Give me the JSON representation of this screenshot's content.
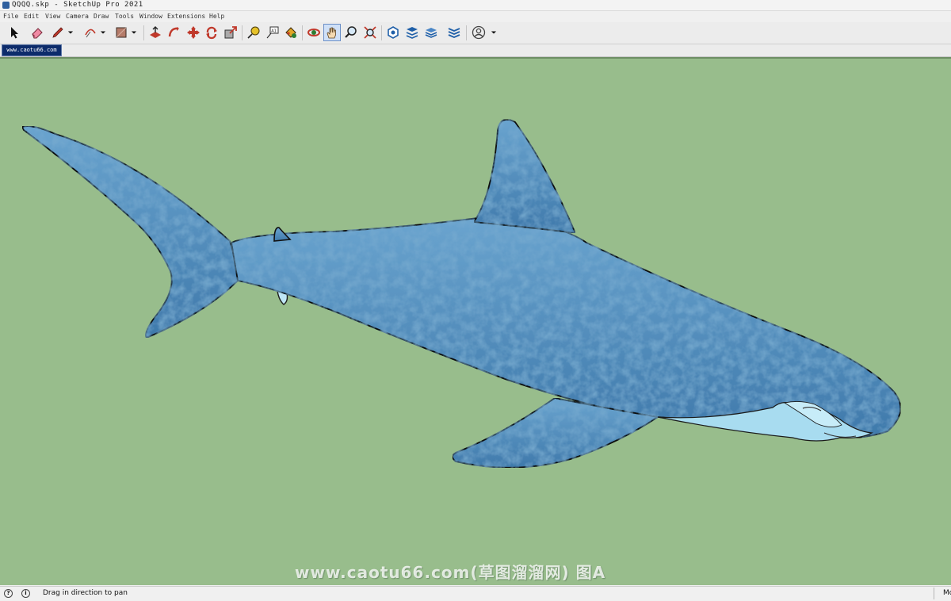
{
  "window": {
    "title": "QQQQ.skp - SketchUp Pro 2021"
  },
  "menu": [
    "File",
    "Edit",
    "View",
    "Camera",
    "Draw",
    "Tools",
    "Window",
    "Extensions",
    "Help"
  ],
  "toolbar": {
    "tools": [
      {
        "name": "select-tool",
        "icon": "arrow-cursor-icon"
      },
      {
        "name": "eraser-tool",
        "icon": "eraser-icon"
      },
      {
        "name": "line-tool",
        "icon": "pencil-icon"
      },
      {
        "name": "arc-tool",
        "icon": "arc-icon"
      },
      {
        "name": "shapes-tool",
        "icon": "rectangle-icon"
      },
      {
        "name": "push-pull-tool",
        "icon": "push-pull-icon"
      },
      {
        "name": "follow-me-tool",
        "icon": "follow-me-icon"
      },
      {
        "name": "move-tool",
        "icon": "move-icon"
      },
      {
        "name": "rotate-tool",
        "icon": "rotate-icon"
      },
      {
        "name": "scale-tool",
        "icon": "scale-icon"
      },
      {
        "name": "tape-measure-tool",
        "icon": "tape-measure-icon"
      },
      {
        "name": "text-tool",
        "icon": "text-icon"
      },
      {
        "name": "paint-bucket-tool",
        "icon": "paint-bucket-icon"
      },
      {
        "name": "orbit-tool",
        "icon": "orbit-icon"
      },
      {
        "name": "pan-tool",
        "icon": "pan-hand-icon",
        "active": true
      },
      {
        "name": "zoom-tool",
        "icon": "zoom-icon"
      },
      {
        "name": "zoom-extents-tool",
        "icon": "zoom-extents-icon"
      },
      {
        "name": "warehouse-tool",
        "icon": "warehouse-icon"
      },
      {
        "name": "extension-warehouse-tool",
        "icon": "extension-warehouse-icon"
      },
      {
        "name": "layout-tool",
        "icon": "layout-icon"
      },
      {
        "name": "extension-manager-tool",
        "icon": "extension-manager-icon"
      },
      {
        "name": "account-tool",
        "icon": "account-icon"
      }
    ]
  },
  "scene_tab": {
    "label": "www.caotu66.com"
  },
  "viewport": {
    "background": "#98bd8c",
    "model": "shark",
    "watermark": "www.caotu66.com(草图溜溜网) 图A"
  },
  "status": {
    "message": "Drag in direction to pan",
    "measurement_label": "Mo"
  },
  "colors": {
    "shark_body": "#4f88b8",
    "shark_belly": "#a8dcf0",
    "accent": "#0d2c6b"
  }
}
